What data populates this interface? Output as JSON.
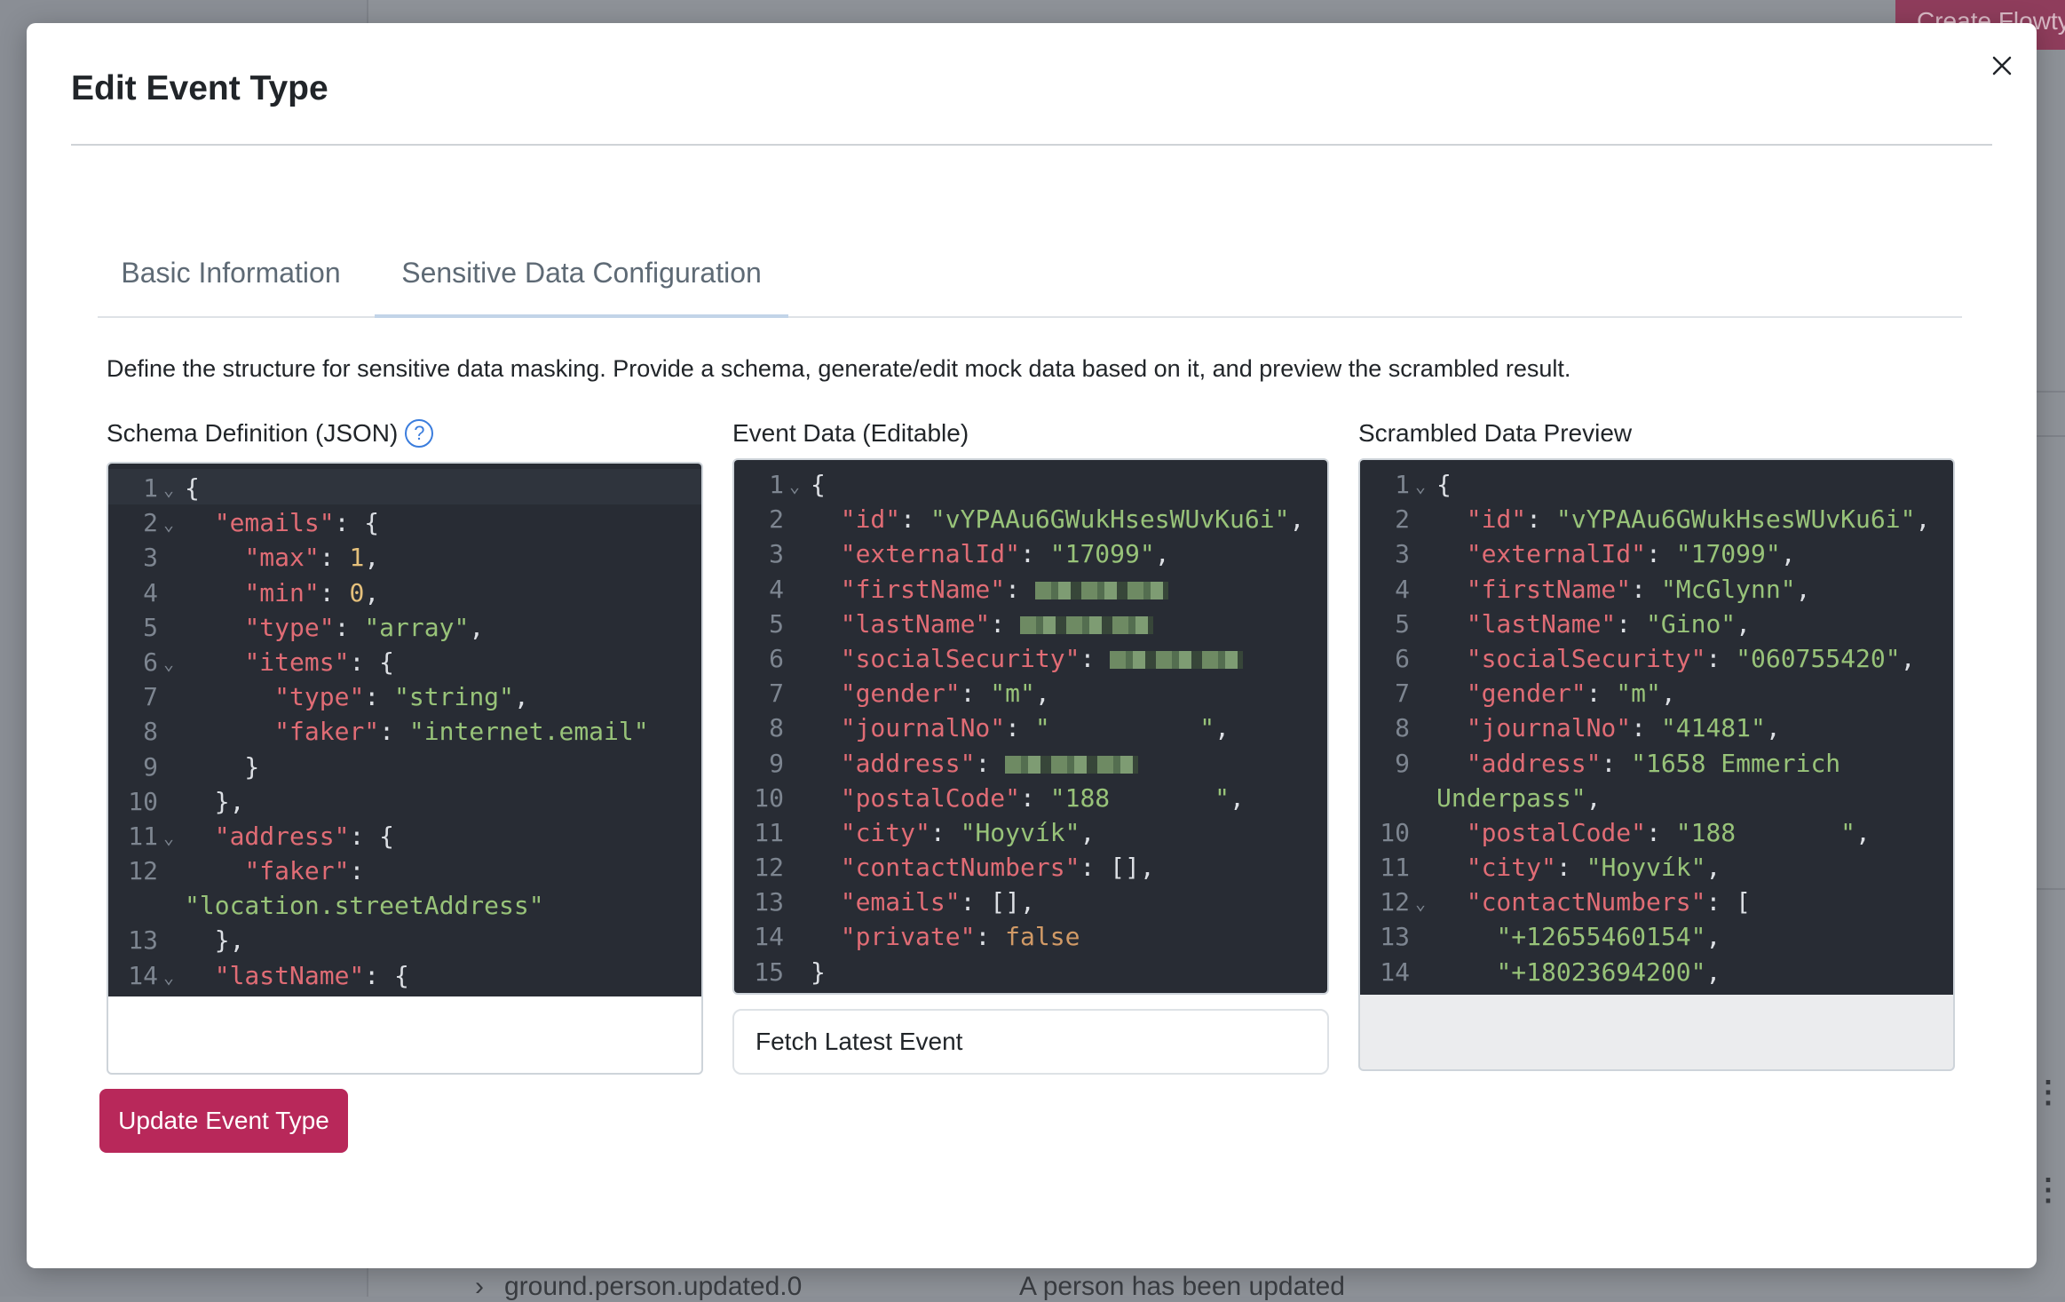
{
  "background": {
    "create_button": "Create Flowty",
    "row_name": "ground.person.updated.0",
    "row_description": "A person has been updated"
  },
  "modal": {
    "title": "Edit Event Type",
    "tabs": [
      {
        "label": "Basic Information",
        "active": false
      },
      {
        "label": "Sensitive Data Configuration",
        "active": true
      }
    ],
    "description": "Define the structure for sensitive data masking. Provide a schema, generate/edit mock data based on it, and preview the scrambled result.",
    "schema_label": "Schema Definition (JSON)",
    "event_label": "Event Data (Editable)",
    "preview_label": "Scrambled Data Preview",
    "fetch_button": "Fetch Latest Event",
    "update_button": "Update Event Type"
  },
  "colors": {
    "primary": "#b8285a",
    "editor_bg": "#282c34",
    "json_key": "#e06c75",
    "json_string": "#98c379",
    "json_number": "#e5c07b",
    "json_boolean": "#d19a66",
    "help_icon": "#3b7ddd"
  },
  "schema_editor": [
    {
      "n": "1",
      "fold": true,
      "tokens": [
        [
          "p",
          "{"
        ]
      ]
    },
    {
      "n": "2",
      "fold": true,
      "tokens": [
        [
          "p",
          "  "
        ],
        [
          "k",
          "\"emails\""
        ],
        [
          "p",
          ": {"
        ]
      ]
    },
    {
      "n": "3",
      "tokens": [
        [
          "p",
          "    "
        ],
        [
          "k",
          "\"max\""
        ],
        [
          "p",
          ": "
        ],
        [
          "n",
          "1"
        ],
        [
          "p",
          ","
        ]
      ]
    },
    {
      "n": "4",
      "tokens": [
        [
          "p",
          "    "
        ],
        [
          "k",
          "\"min\""
        ],
        [
          "p",
          ": "
        ],
        [
          "n",
          "0"
        ],
        [
          "p",
          ","
        ]
      ]
    },
    {
      "n": "5",
      "tokens": [
        [
          "p",
          "    "
        ],
        [
          "k",
          "\"type\""
        ],
        [
          "p",
          ": "
        ],
        [
          "s",
          "\"array\""
        ],
        [
          "p",
          ","
        ]
      ]
    },
    {
      "n": "6",
      "fold": true,
      "tokens": [
        [
          "p",
          "    "
        ],
        [
          "k",
          "\"items\""
        ],
        [
          "p",
          ": {"
        ]
      ]
    },
    {
      "n": "7",
      "tokens": [
        [
          "p",
          "      "
        ],
        [
          "k",
          "\"type\""
        ],
        [
          "p",
          ": "
        ],
        [
          "s",
          "\"string\""
        ],
        [
          "p",
          ","
        ]
      ]
    },
    {
      "n": "8",
      "tokens": [
        [
          "p",
          "      "
        ],
        [
          "k",
          "\"faker\""
        ],
        [
          "p",
          ": "
        ],
        [
          "s",
          "\"internet.email\""
        ]
      ]
    },
    {
      "n": "9",
      "tokens": [
        [
          "p",
          "    }"
        ]
      ]
    },
    {
      "n": "10",
      "tokens": [
        [
          "p",
          "  },"
        ]
      ]
    },
    {
      "n": "11",
      "fold": true,
      "tokens": [
        [
          "p",
          "  "
        ],
        [
          "k",
          "\"address\""
        ],
        [
          "p",
          ": {"
        ]
      ]
    },
    {
      "n": "12",
      "wrap": true,
      "tokens": [
        [
          "p",
          "    "
        ],
        [
          "k",
          "\"faker\""
        ],
        [
          "p",
          ":\n"
        ],
        [
          "s",
          "\"location.streetAddress\""
        ]
      ]
    },
    {
      "n": "13",
      "tokens": [
        [
          "p",
          "  },"
        ]
      ]
    },
    {
      "n": "14",
      "fold": true,
      "tokens": [
        [
          "p",
          "  "
        ],
        [
          "k",
          "\"lastName\""
        ],
        [
          "p",
          ": {"
        ]
      ]
    }
  ],
  "event_editor": [
    {
      "n": "1",
      "fold": true,
      "tokens": [
        [
          "p",
          "{"
        ]
      ]
    },
    {
      "n": "2",
      "tokens": [
        [
          "p",
          "  "
        ],
        [
          "k",
          "\"id\""
        ],
        [
          "p",
          ": "
        ],
        [
          "s",
          "\"vYPAAu6GWukHsesWUvKu6i\""
        ],
        [
          "p",
          ","
        ]
      ]
    },
    {
      "n": "3",
      "tokens": [
        [
          "p",
          "  "
        ],
        [
          "k",
          "\"externalId\""
        ],
        [
          "p",
          ": "
        ],
        [
          "s",
          "\"17099\""
        ],
        [
          "p",
          ","
        ]
      ]
    },
    {
      "n": "4",
      "tokens": [
        [
          "p",
          "  "
        ],
        [
          "k",
          "\"firstName\""
        ],
        [
          "p",
          ": "
        ]
      ],
      "redacted": true
    },
    {
      "n": "5",
      "tokens": [
        [
          "p",
          "  "
        ],
        [
          "k",
          "\"lastName\""
        ],
        [
          "p",
          ": "
        ]
      ],
      "redacted": true
    },
    {
      "n": "6",
      "tokens": [
        [
          "p",
          "  "
        ],
        [
          "k",
          "\"socialSecurity\""
        ],
        [
          "p",
          ": "
        ]
      ],
      "redacted": true
    },
    {
      "n": "7",
      "tokens": [
        [
          "p",
          "  "
        ],
        [
          "k",
          "\"gender\""
        ],
        [
          "p",
          ": "
        ],
        [
          "s",
          "\"m\""
        ],
        [
          "p",
          ","
        ]
      ]
    },
    {
      "n": "8",
      "tokens": [
        [
          "p",
          "  "
        ],
        [
          "k",
          "\"journalNo\""
        ],
        [
          "p",
          ": "
        ],
        [
          "s",
          "\"          \""
        ],
        [
          "p",
          ","
        ]
      ]
    },
    {
      "n": "9",
      "tokens": [
        [
          "p",
          "  "
        ],
        [
          "k",
          "\"address\""
        ],
        [
          "p",
          ": "
        ]
      ],
      "redacted": true
    },
    {
      "n": "10",
      "tokens": [
        [
          "p",
          "  "
        ],
        [
          "k",
          "\"postalCode\""
        ],
        [
          "p",
          ": "
        ],
        [
          "s",
          "\"188       \""
        ],
        [
          "p",
          ","
        ]
      ]
    },
    {
      "n": "11",
      "tokens": [
        [
          "p",
          "  "
        ],
        [
          "k",
          "\"city\""
        ],
        [
          "p",
          ": "
        ],
        [
          "s",
          "\"Hoyvík\""
        ],
        [
          "p",
          ","
        ]
      ]
    },
    {
      "n": "12",
      "tokens": [
        [
          "p",
          "  "
        ],
        [
          "k",
          "\"contactNumbers\""
        ],
        [
          "p",
          ": [],"
        ]
      ]
    },
    {
      "n": "13",
      "tokens": [
        [
          "p",
          "  "
        ],
        [
          "k",
          "\"emails\""
        ],
        [
          "p",
          ": [],"
        ]
      ]
    },
    {
      "n": "14",
      "tokens": [
        [
          "p",
          "  "
        ],
        [
          "k",
          "\"private\""
        ],
        [
          "p",
          ": "
        ],
        [
          "b",
          "false"
        ]
      ]
    },
    {
      "n": "15",
      "tokens": [
        [
          "p",
          "}"
        ]
      ]
    }
  ],
  "preview_editor": [
    {
      "n": "1",
      "fold": true,
      "tokens": [
        [
          "p",
          "{"
        ]
      ]
    },
    {
      "n": "2",
      "tokens": [
        [
          "p",
          "  "
        ],
        [
          "k",
          "\"id\""
        ],
        [
          "p",
          ": "
        ],
        [
          "s",
          "\"vYPAAu6GWukHsesWUvKu6i\""
        ],
        [
          "p",
          ","
        ]
      ]
    },
    {
      "n": "3",
      "tokens": [
        [
          "p",
          "  "
        ],
        [
          "k",
          "\"externalId\""
        ],
        [
          "p",
          ": "
        ],
        [
          "s",
          "\"17099\""
        ],
        [
          "p",
          ","
        ]
      ]
    },
    {
      "n": "4",
      "tokens": [
        [
          "p",
          "  "
        ],
        [
          "k",
          "\"firstName\""
        ],
        [
          "p",
          ": "
        ],
        [
          "s",
          "\"McGlynn\""
        ],
        [
          "p",
          ","
        ]
      ]
    },
    {
      "n": "5",
      "tokens": [
        [
          "p",
          "  "
        ],
        [
          "k",
          "\"lastName\""
        ],
        [
          "p",
          ": "
        ],
        [
          "s",
          "\"Gino\""
        ],
        [
          "p",
          ","
        ]
      ]
    },
    {
      "n": "6",
      "tokens": [
        [
          "p",
          "  "
        ],
        [
          "k",
          "\"socialSecurity\""
        ],
        [
          "p",
          ": "
        ],
        [
          "s",
          "\"060755420\""
        ],
        [
          "p",
          ","
        ]
      ]
    },
    {
      "n": "7",
      "tokens": [
        [
          "p",
          "  "
        ],
        [
          "k",
          "\"gender\""
        ],
        [
          "p",
          ": "
        ],
        [
          "s",
          "\"m\""
        ],
        [
          "p",
          ","
        ]
      ]
    },
    {
      "n": "8",
      "tokens": [
        [
          "p",
          "  "
        ],
        [
          "k",
          "\"journalNo\""
        ],
        [
          "p",
          ": "
        ],
        [
          "s",
          "\"41481\""
        ],
        [
          "p",
          ","
        ]
      ]
    },
    {
      "n": "9",
      "wrap": true,
      "tokens": [
        [
          "p",
          "  "
        ],
        [
          "k",
          "\"address\""
        ],
        [
          "p",
          ": "
        ],
        [
          "s",
          "\"1658 Emmerich\nUnderpass\""
        ],
        [
          "p",
          ","
        ]
      ]
    },
    {
      "n": "10",
      "tokens": [
        [
          "p",
          "  "
        ],
        [
          "k",
          "\"postalCode\""
        ],
        [
          "p",
          ": "
        ],
        [
          "s",
          "\"188       \""
        ],
        [
          "p",
          ","
        ]
      ]
    },
    {
      "n": "11",
      "tokens": [
        [
          "p",
          "  "
        ],
        [
          "k",
          "\"city\""
        ],
        [
          "p",
          ": "
        ],
        [
          "s",
          "\"Hoyvík\""
        ],
        [
          "p",
          ","
        ]
      ]
    },
    {
      "n": "12",
      "fold": true,
      "tokens": [
        [
          "p",
          "  "
        ],
        [
          "k",
          "\"contactNumbers\""
        ],
        [
          "p",
          ": ["
        ]
      ]
    },
    {
      "n": "13",
      "tokens": [
        [
          "p",
          "    "
        ],
        [
          "s",
          "\"+12655460154\""
        ],
        [
          "p",
          ","
        ]
      ]
    },
    {
      "n": "14",
      "tokens": [
        [
          "p",
          "    "
        ],
        [
          "s",
          "\"+18023694200\""
        ],
        [
          "p",
          ","
        ]
      ]
    }
  ]
}
